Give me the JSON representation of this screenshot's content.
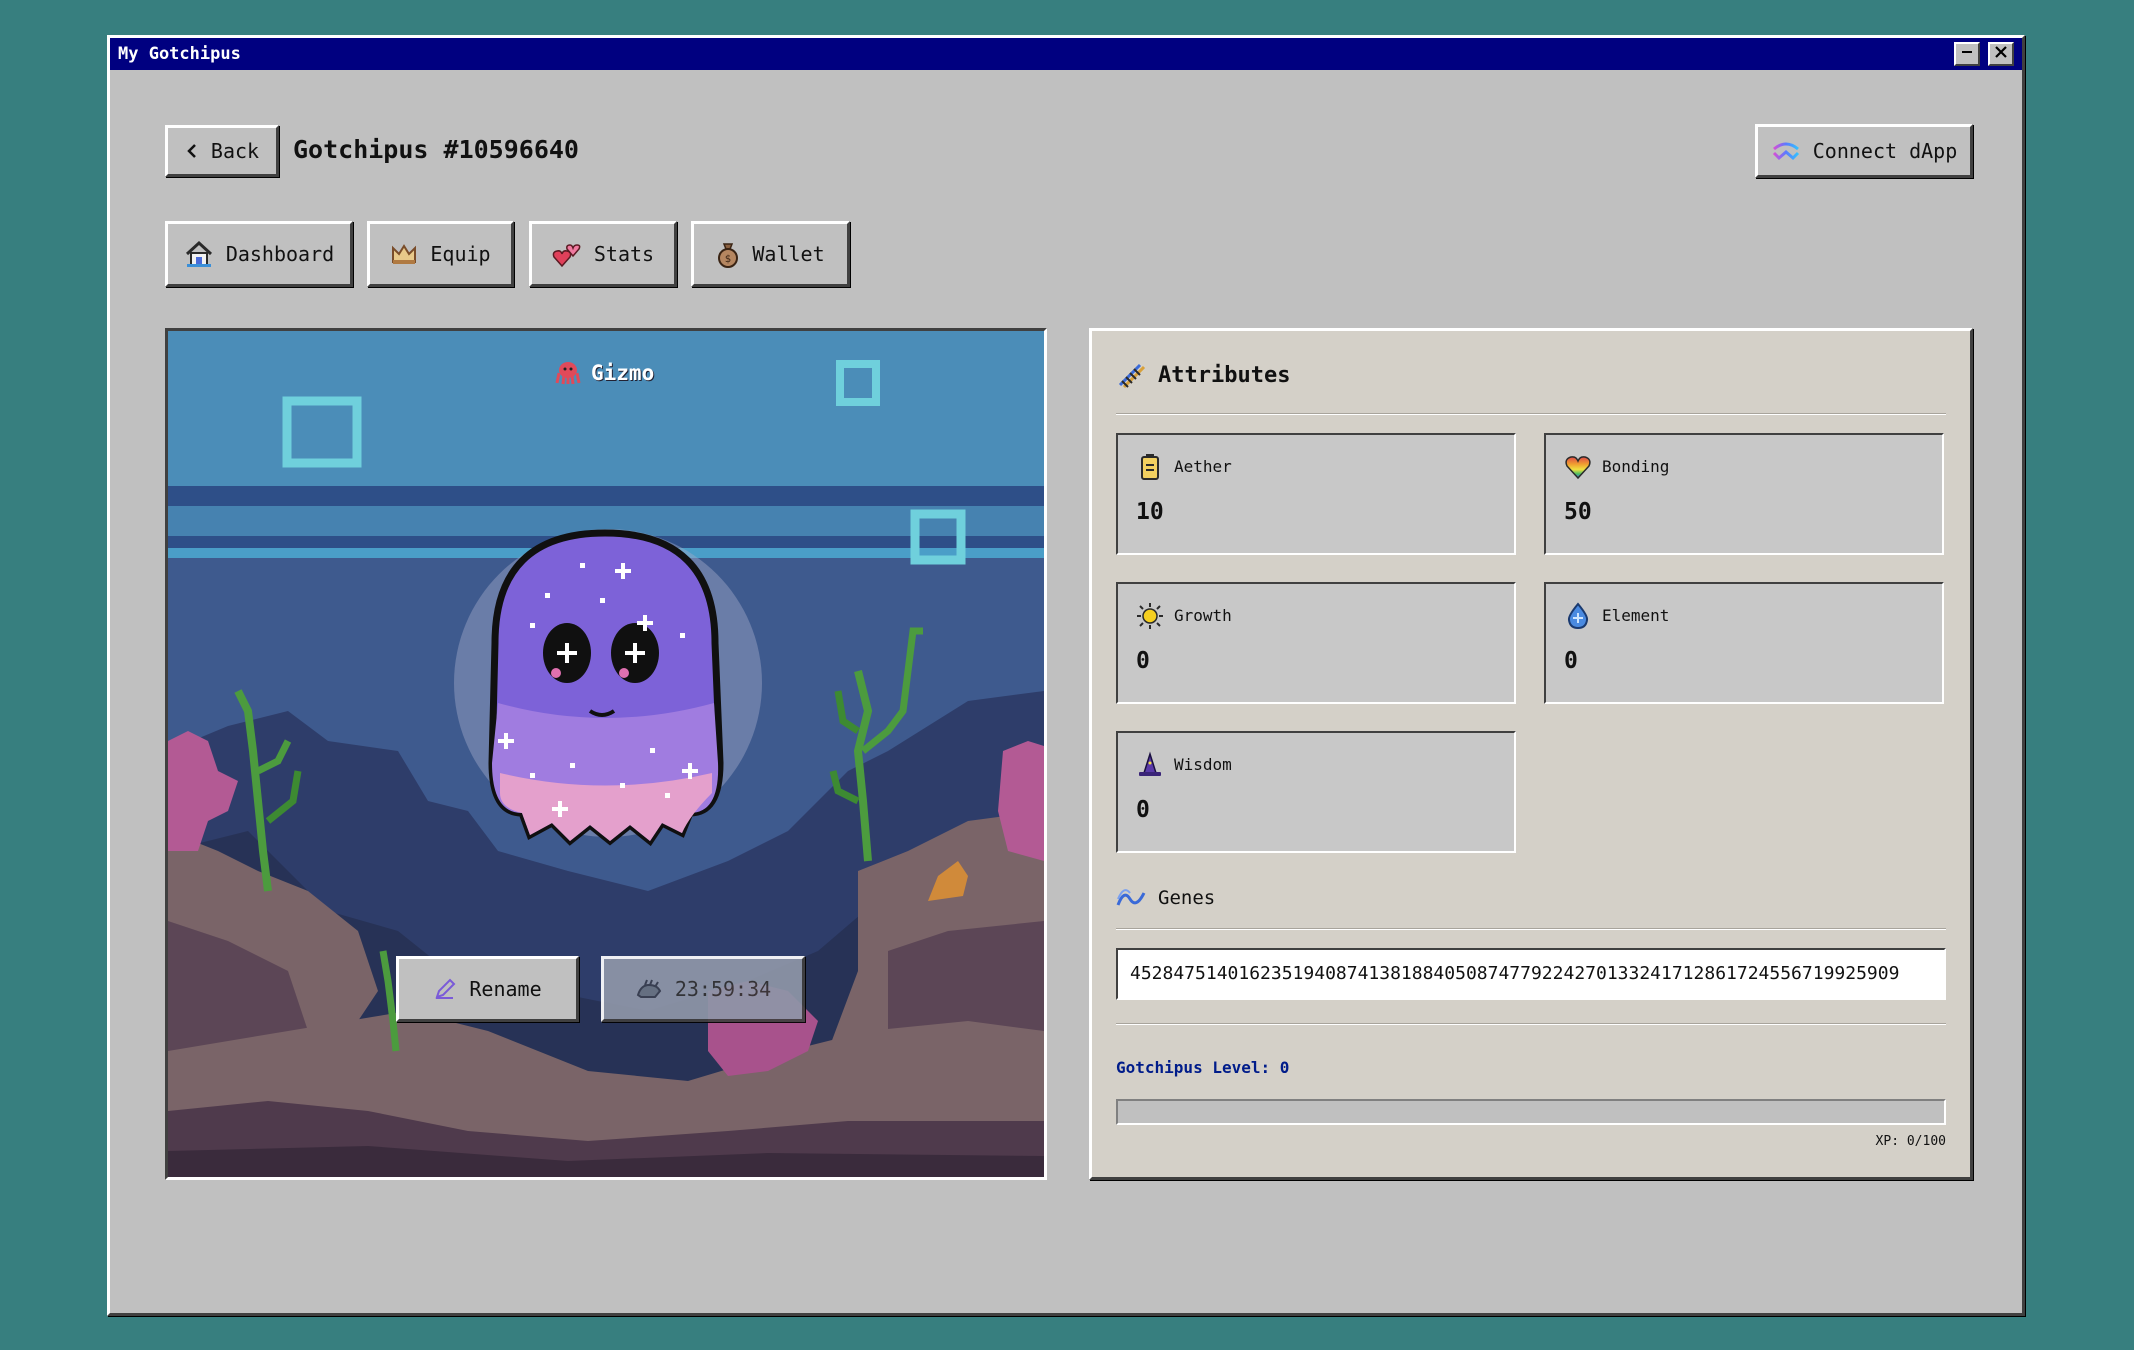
{
  "window": {
    "title": "My Gotchipus"
  },
  "header": {
    "back_label": "Back",
    "page_title": "Gotchipus #10596640",
    "connect_label": "Connect dApp"
  },
  "tabs": [
    {
      "label": "Dashboard",
      "icon": "house-icon"
    },
    {
      "label": "Equip",
      "icon": "crown-icon"
    },
    {
      "label": "Stats",
      "icon": "hearts-icon"
    },
    {
      "label": "Wallet",
      "icon": "money-bag-icon"
    }
  ],
  "scene": {
    "pet_name": "Gizmo",
    "rename_label": "Rename",
    "timer": "23:59:34"
  },
  "attributes": {
    "title": "Attributes",
    "items": [
      {
        "name": "Aether",
        "value": "10",
        "icon": "aether-icon"
      },
      {
        "name": "Bonding",
        "value": "50",
        "icon": "heart-icon"
      },
      {
        "name": "Growth",
        "value": "0",
        "icon": "sun-icon"
      },
      {
        "name": "Element",
        "value": "0",
        "icon": "water-drop-icon"
      },
      {
        "name": "Wisdom",
        "value": "0",
        "icon": "wizard-hat-icon"
      }
    ]
  },
  "genes": {
    "title": "Genes",
    "value": "45284751401623519408741381884050874779224270133241712861724556719925909"
  },
  "level": {
    "label": "Gotchipus Level: 0",
    "xp_text": "XP: 0/100",
    "xp_fraction": 0
  },
  "colors": {
    "desktop": "#377f7f",
    "titlebar": "#000080",
    "window": "#c0c0c0"
  }
}
